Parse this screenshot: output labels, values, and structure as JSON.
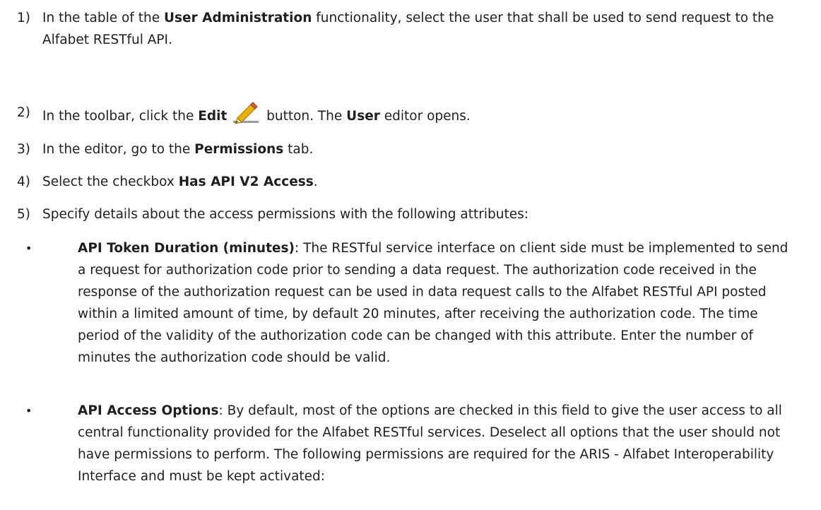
{
  "steps": [
    {
      "num": "1)",
      "t1": "In the table of the ",
      "b1": "User Administration",
      "t2": " functionality, select the user that shall be used to send request to the Alfabet RESTful API."
    },
    {
      "num": "2)",
      "t1": "In the toolbar, click the ",
      "b1": "Edit",
      "icon": "edit-pencil-icon",
      "t2": " button. The ",
      "b2": "User",
      "t3": " editor opens."
    },
    {
      "num": "3)",
      "t1": "In the editor, go to the ",
      "b1": "Permissions",
      "t2": " tab."
    },
    {
      "num": "4)",
      "t1": "Select the checkbox ",
      "b1": "Has API V2 Access",
      "t2": "."
    },
    {
      "num": "5)",
      "t1": "Specify details about the access permissions with the following attributes:"
    }
  ],
  "bullets": [
    {
      "dot": "•",
      "title": "API Token Duration (minutes)",
      "text": ": The RESTful service interface on client side must be implemented to send a request for authorization code prior to sending a data request. The authorization code received in the response of the authorization request can be used in data request calls to the Alfabet RESTful API posted within a limited amount of time, by default 20 minutes, after receiving the authorization code. The time period of the validity of the authorization code can be changed with this attribute. Enter the number of minutes the authorization code should be valid."
    },
    {
      "dot": "•",
      "title": "API Access Options",
      "text": ": By default, most of the options are checked in this field to give the user access to all central functionality provided for the Alfabet RESTful services. Deselect all options that the user should not have permissions to perform. The following permissions are required for the ARIS - Alfabet Interoperability Interface and must be kept activated:"
    }
  ],
  "colors": {
    "text": "#1f1f1f",
    "pencil_body": "#e8b000",
    "pencil_tip": "#3c6e1a"
  }
}
